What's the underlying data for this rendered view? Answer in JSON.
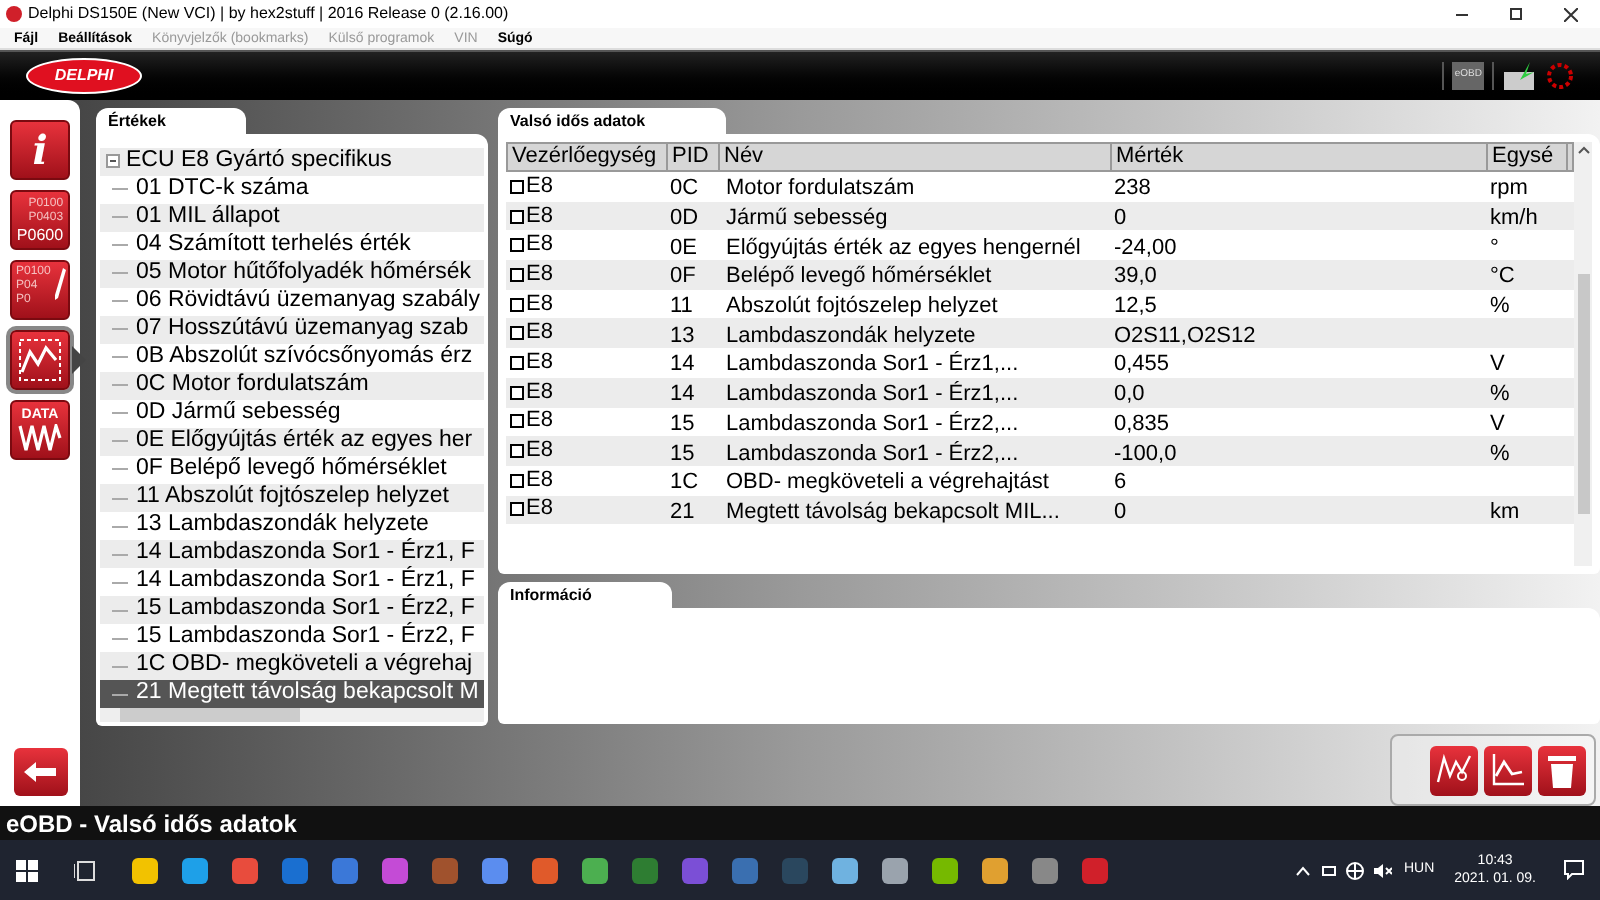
{
  "window": {
    "title": "Delphi DS150E (New VCI) | by hex2stuff | 2016 Release 0 (2.16.00)"
  },
  "menu": [
    {
      "label": "Fájl",
      "disabled": false
    },
    {
      "label": "Beállítások",
      "disabled": false
    },
    {
      "label": "Könyvjelzők (bookmarks)",
      "disabled": true
    },
    {
      "label": "Külső programok",
      "disabled": true
    },
    {
      "label": "VIN",
      "disabled": true
    },
    {
      "label": "Súgó",
      "disabled": false
    }
  ],
  "header": {
    "logo": "DELPHI",
    "mode_badge": "eOBD"
  },
  "sidebar": {
    "items": [
      {
        "kind": "info",
        "selected": false,
        "lines": [
          "i"
        ]
      },
      {
        "kind": "codes",
        "selected": false,
        "lines": [
          "P0100",
          "P0403",
          "P0600"
        ]
      },
      {
        "kind": "erase",
        "selected": false,
        "lines": [
          "P0100",
          "P04",
          "P0"
        ]
      },
      {
        "kind": "live",
        "selected": true
      },
      {
        "kind": "data",
        "selected": false,
        "lines": [
          "DATA"
        ]
      }
    ]
  },
  "values_panel": {
    "title": "Értékek",
    "tree": [
      {
        "label": "ECU E8 Gyártó specifikus",
        "expanded": true,
        "children": [
          {
            "label": "01 DTC-k száma",
            "selected": false
          },
          {
            "label": "01 MIL állapot",
            "selected": false
          },
          {
            "label": "04 Számított terhelés érték",
            "selected": false
          },
          {
            "label": "05 Motor hűtőfolyadék hőmérsék",
            "selected": false
          },
          {
            "label": "06 Rövidtávú üzemanyag szabály",
            "selected": false
          },
          {
            "label": "07 Hosszútávú üzemanyag szab",
            "selected": false
          },
          {
            "label": "0B Abszolút szívócsőnyomás érz",
            "selected": false
          },
          {
            "label": "0C Motor fordulatszám",
            "selected": false
          },
          {
            "label": "0D Jármű sebesség",
            "selected": false
          },
          {
            "label": "0E Előgyújtás érték az egyes her",
            "selected": false
          },
          {
            "label": "0F Belépő levegő hőmérséklet",
            "selected": false
          },
          {
            "label": "11 Abszolút fojtószelep helyzet",
            "selected": false
          },
          {
            "label": "13 Lambdaszondák helyzete",
            "selected": false
          },
          {
            "label": "14 Lambdaszonda Sor1 - Érz1, F",
            "selected": false
          },
          {
            "label": "14 Lambdaszonda Sor1 - Érz1, F",
            "selected": false
          },
          {
            "label": "15 Lambdaszonda Sor1 - Érz2, F",
            "selected": false
          },
          {
            "label": "15 Lambdaszonda Sor1 - Érz2, F",
            "selected": false
          },
          {
            "label": "1C OBD- megköveteli a végrehaj",
            "selected": false
          },
          {
            "label": "21 Megtett távolság bekapcsolt M",
            "selected": true
          }
        ]
      }
    ]
  },
  "live_panel": {
    "title": "Valsó idős adatok",
    "table": {
      "columns": [
        "Vezérlőegység",
        "PID",
        "Név",
        "Mérték",
        "Egysé"
      ],
      "rows": [
        {
          "checked": false,
          "ecu": "E8",
          "pid": "0C",
          "name": "Motor fordulatszám",
          "value": "238",
          "unit": "rpm"
        },
        {
          "checked": false,
          "ecu": "E8",
          "pid": "0D",
          "name": "Jármű sebesség",
          "value": "0",
          "unit": "km/h"
        },
        {
          "checked": false,
          "ecu": "E8",
          "pid": "0E",
          "name": "Előgyújtás érték az egyes hengernél",
          "value": "-24,00",
          "unit": "°"
        },
        {
          "checked": false,
          "ecu": "E8",
          "pid": "0F",
          "name": "Belépő levegő hőmérséklet",
          "value": "39,0",
          "unit": "°C"
        },
        {
          "checked": false,
          "ecu": "E8",
          "pid": "11",
          "name": "Abszolút fojtószelep helyzet",
          "value": "12,5",
          "unit": "%"
        },
        {
          "checked": false,
          "ecu": "E8",
          "pid": "13",
          "name": "Lambdaszondák helyzete",
          "value": "O2S11,O2S12",
          "unit": ""
        },
        {
          "checked": false,
          "ecu": "E8",
          "pid": "14",
          "name": "Lambdaszonda Sor1 - Érz1,...",
          "value": "0,455",
          "unit": "V"
        },
        {
          "checked": false,
          "ecu": "E8",
          "pid": "14",
          "name": "Lambdaszonda Sor1 - Érz1,...",
          "value": "0,0",
          "unit": "%"
        },
        {
          "checked": false,
          "ecu": "E8",
          "pid": "15",
          "name": "Lambdaszonda Sor1 - Érz2,...",
          "value": "0,835",
          "unit": "V"
        },
        {
          "checked": false,
          "ecu": "E8",
          "pid": "15",
          "name": "Lambdaszonda Sor1 - Érz2,...",
          "value": "-100,0",
          "unit": "%"
        },
        {
          "checked": false,
          "ecu": "E8",
          "pid": "1C",
          "name": "OBD- megköveteli a végrehajtást",
          "value": "6",
          "unit": ""
        },
        {
          "checked": false,
          "ecu": "E8",
          "pid": "21",
          "name": "Megtett távolság bekapcsolt MIL...",
          "value": "0",
          "unit": "km"
        }
      ]
    }
  },
  "info_panel": {
    "title": "Információ"
  },
  "status_bar": {
    "text": "eOBD - Valsó idős adatok"
  },
  "taskbar": {
    "language": "HUN",
    "time": "10:43",
    "date": "2021. 01. 09."
  }
}
